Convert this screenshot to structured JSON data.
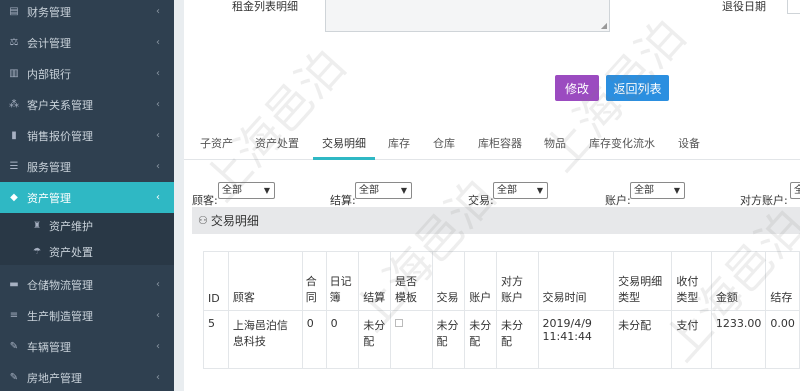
{
  "sidebar": {
    "items": [
      {
        "label": "财务管理",
        "icon": "finance-icon",
        "glyph": "▤"
      },
      {
        "label": "会计管理",
        "icon": "scale-icon",
        "glyph": "⚖"
      },
      {
        "label": "内部银行",
        "icon": "bank-icon",
        "glyph": "▥"
      },
      {
        "label": "客户关系管理",
        "icon": "network-icon",
        "glyph": "⁂"
      },
      {
        "label": "销售报价管理",
        "icon": "bar-chart-icon",
        "glyph": "▮"
      },
      {
        "label": "服务管理",
        "icon": "list-icon",
        "glyph": "☰"
      },
      {
        "label": "资产管理",
        "icon": "diamond-icon",
        "glyph": "◆"
      }
    ],
    "sub_items": [
      {
        "label": "资产维护",
        "icon": "trophy-icon",
        "glyph": "♜"
      },
      {
        "label": "资产处置",
        "icon": "umbrella-icon",
        "glyph": "☂"
      }
    ],
    "items_after": [
      {
        "label": "仓储物流管理",
        "icon": "truck-icon",
        "glyph": "▬"
      },
      {
        "label": "生产制造管理",
        "icon": "sliders-icon",
        "glyph": "≡"
      },
      {
        "label": "车辆管理",
        "icon": "edit-icon",
        "glyph": "✎"
      },
      {
        "label": "房地产管理",
        "icon": "edit-icon",
        "glyph": "✎"
      }
    ],
    "chevron": "‹"
  },
  "form": {
    "rent_label": "租金列表明细",
    "return_date_label": "退役日期"
  },
  "buttons": {
    "edit": "修改",
    "back": "返回列表"
  },
  "tabs": [
    "子资产",
    "资产处置",
    "交易明细",
    "库存",
    "仓库",
    "库柜容器",
    "物品",
    "库存变化流水",
    "设备"
  ],
  "filters": [
    {
      "label": "顾客:",
      "value": "全部"
    },
    {
      "label": "结算:",
      "value": "全部"
    },
    {
      "label": "交易:",
      "value": "全部"
    },
    {
      "label": "账户:",
      "value": "全部"
    },
    {
      "label": "对方账户:",
      "value": "全"
    }
  ],
  "panel_title": "交易明细",
  "table": {
    "headers": [
      "ID",
      "顾客",
      "合同",
      "日记簿",
      "结算",
      "是否模板",
      "交易",
      "账户",
      "对方账户",
      "交易时间",
      "交易明细类型",
      "收付类型",
      "金额",
      "结存"
    ],
    "rows": [
      [
        "5",
        "上海邑泊信息科技",
        "0",
        "0",
        "未分配",
        "",
        "未分配",
        "未分配",
        "未分配",
        "2019/4/9 11:41:44",
        "未分配",
        "支付",
        "1233.00",
        "0.00"
      ]
    ]
  },
  "watermark": "上海邑泊"
}
